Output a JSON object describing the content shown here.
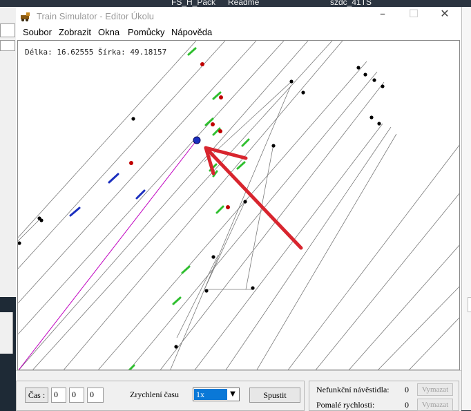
{
  "desktop": {
    "labels": [
      "FS_H_Pack",
      "Readme",
      "szdc_41TS"
    ]
  },
  "window": {
    "title": "Train Simulator - Editor Úkolu",
    "app_icon": "train-app-icon",
    "controls": {
      "minimize": "–",
      "maximize": "☐",
      "close": "✕"
    }
  },
  "menu": [
    "Soubor",
    "Zobrazit",
    "Okna",
    "Pomůcky",
    "Nápověda"
  ],
  "map": {
    "coords_text": "Délka: 16.62555 Šírka: 49.18157",
    "colors": {
      "track": "#7a7a7a",
      "signal_green": "#2fbf2f",
      "signal_blue": "#1b2fbf",
      "marker_red": "#c00000",
      "node_black": "#000000",
      "arrow_red": "#d8252e",
      "route_magenta": "#c000c0"
    }
  },
  "controls": {
    "time_button": "Čas :",
    "time_fields": [
      "0",
      "0",
      "0"
    ],
    "speedup_label": "Zrychlení času",
    "speedup_value": "1x",
    "run_button": "Spustit"
  },
  "stats": [
    {
      "label": "Nefunkční návěstidla:",
      "value": "0",
      "button": "Vymazat"
    },
    {
      "label": "Pomalé rychlosti:",
      "value": "0",
      "button": "Vymazat"
    }
  ]
}
